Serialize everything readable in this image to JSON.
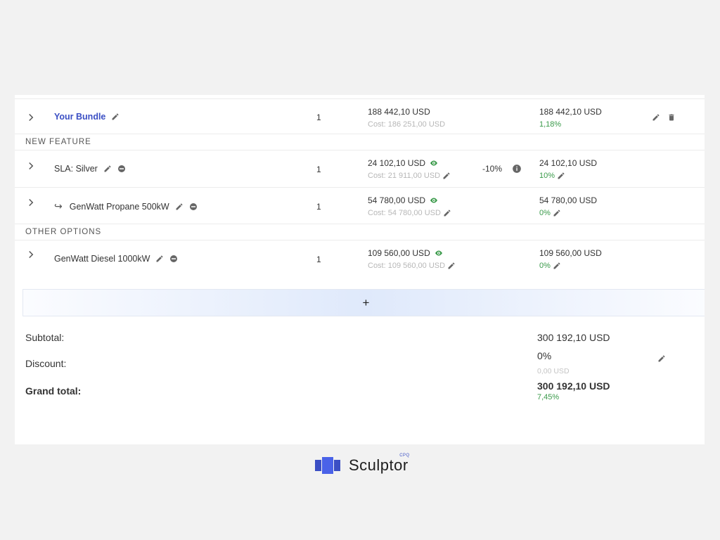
{
  "rows": [
    {
      "name": "Your Bundle",
      "qty": "1",
      "price": "188 442,10 USD",
      "cost": "Cost: 186 251,00 USD",
      "total": "188 442,10 USD",
      "pct": "1,18%"
    },
    {
      "name": "SLA: Silver",
      "qty": "1",
      "price": "24 102,10 USD",
      "cost": "Cost: 21 911,00 USD",
      "discount": "-10%",
      "total": "24 102,10 USD",
      "pct": "10%"
    },
    {
      "name": "GenWatt Propane 500kW",
      "qty": "1",
      "price": "54 780,00 USD",
      "cost": "Cost: 54 780,00 USD",
      "total": "54 780,00 USD",
      "pct": "0%"
    },
    {
      "name": "GenWatt Diesel 1000kW",
      "qty": "1",
      "price": "109 560,00 USD",
      "cost": "Cost: 109 560,00 USD",
      "total": "109 560,00 USD",
      "pct": "0%"
    }
  ],
  "sections": {
    "new_feature": "NEW FEATURE",
    "other_options": "OTHER OPTIONS"
  },
  "add_bar": {
    "label": "+"
  },
  "summary": {
    "subtotal_label": "Subtotal:",
    "subtotal_value": "300 192,10 USD",
    "discount_label": "Discount:",
    "discount_pct": "0%",
    "discount_amount": "0,00 USD",
    "grand_label": "Grand total:",
    "grand_value": "300 192,10 USD",
    "grand_pct": "7,45%"
  },
  "brand": {
    "name": "Sculptor",
    "sup": "CPQ"
  },
  "colors": {
    "accent": "#3b4fc4",
    "positive": "#3a9a4a",
    "muted": "#b7b7b7"
  }
}
